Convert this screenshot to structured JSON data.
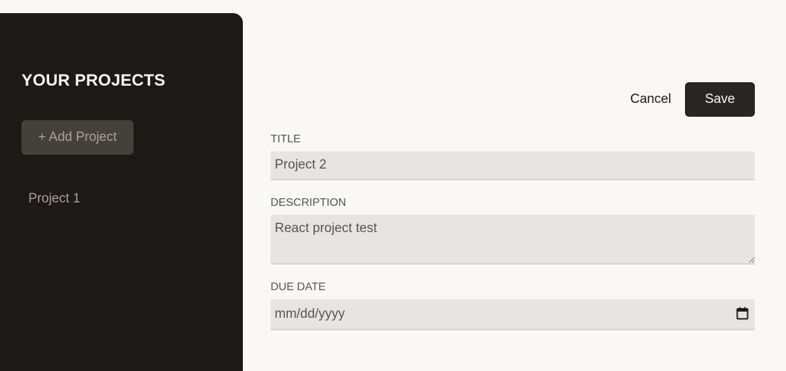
{
  "sidebar": {
    "title": "YOUR PROJECTS",
    "add_button_label": "+ Add Project",
    "projects": [
      {
        "label": "Project 1"
      }
    ]
  },
  "actions": {
    "cancel_label": "Cancel",
    "save_label": "Save"
  },
  "form": {
    "title": {
      "label": "Title",
      "value": "Project 2"
    },
    "description": {
      "label": "Description",
      "value": "React project test"
    },
    "due_date": {
      "label": "Due Date",
      "placeholder": "mm/dd/yyyy"
    }
  },
  "icons": {
    "calendar": "calendar-icon"
  },
  "colors": {
    "sidebar_bg": "#1c1917",
    "page_bg": "#f9f8f7",
    "input_bg": "#e7e5e4",
    "save_bg": "#292524",
    "add_button_bg": "#44403c"
  }
}
